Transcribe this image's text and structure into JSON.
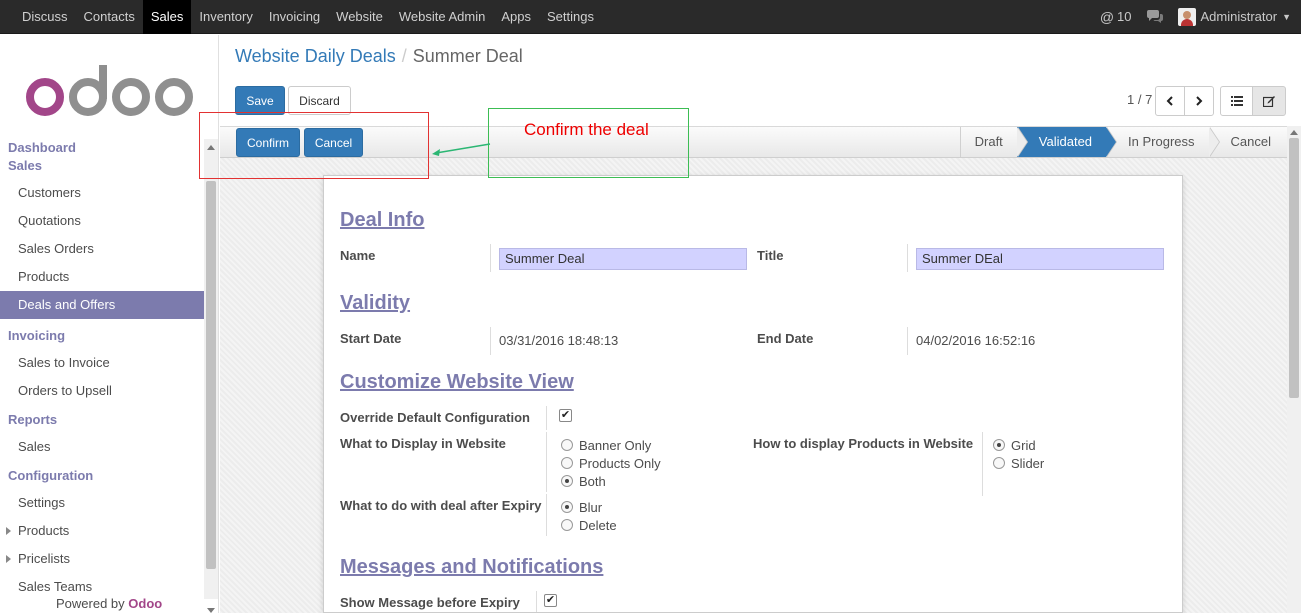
{
  "topbar": {
    "menu": [
      "Discuss",
      "Contacts",
      "Sales",
      "Inventory",
      "Invoicing",
      "Website",
      "Website Admin",
      "Apps",
      "Settings"
    ],
    "active": "Sales",
    "mentions": "10",
    "user": "Administrator"
  },
  "sidebar": {
    "logo_text": "odoo",
    "sections": [
      {
        "head": "Dashboard",
        "items": []
      },
      {
        "head": "Sales",
        "items": [
          "Customers",
          "Quotations",
          "Sales Orders",
          "Products",
          "Deals and Offers"
        ]
      },
      {
        "head": "Invoicing",
        "items": [
          "Sales to Invoice",
          "Orders to Upsell"
        ]
      },
      {
        "head": "Reports",
        "items": [
          "Sales"
        ]
      },
      {
        "head": "Configuration",
        "items": [
          "Settings",
          "Products",
          "Pricelists",
          "Sales Teams"
        ]
      }
    ],
    "active_item": "Deals and Offers",
    "powered_prefix": "Powered by",
    "powered_brand": "Odoo"
  },
  "breadcrumb": {
    "parent": "Website Daily Deals",
    "sep": "/",
    "current": "Summer Deal"
  },
  "buttons": {
    "save": "Save",
    "discard": "Discard",
    "confirm": "Confirm",
    "cancel": "Cancel"
  },
  "pager": {
    "text": "1 / 7"
  },
  "stages": {
    "items": [
      "Draft",
      "Validated",
      "In Progress",
      "Cancel"
    ],
    "active": "Validated"
  },
  "annotation": {
    "text": "Confirm the deal"
  },
  "form": {
    "deal_info": {
      "title": "Deal Info",
      "name_label": "Name",
      "name_value": "Summer Deal",
      "title_label": "Title",
      "title_value": "Summer DEal"
    },
    "validity": {
      "title": "Validity",
      "start_label": "Start Date",
      "start_value": "03/31/2016 18:48:13",
      "end_label": "End Date",
      "end_value": "04/02/2016 16:52:16"
    },
    "customize": {
      "title": "Customize Website View",
      "override_label": "Override Default Configuration",
      "override_checked": true,
      "display_label": "What to Display in Website",
      "display_options": [
        "Banner Only",
        "Products Only",
        "Both"
      ],
      "display_selected": "Both",
      "products_label": "How to display Products in Website",
      "products_options": [
        "Grid",
        "Slider"
      ],
      "products_selected": "Grid",
      "expiry_label": "What to do with deal after Expiry",
      "expiry_options": [
        "Blur",
        "Delete"
      ],
      "expiry_selected": "Blur"
    },
    "messages": {
      "title": "Messages and Notifications",
      "show_msg_label": "Show Message before Expiry",
      "show_msg_checked": true
    }
  },
  "colors": {
    "brand": "#7c7bad",
    "primary": "#337ab7",
    "topbar": "#2a2a2a",
    "input_bg": "#d2d2ff"
  }
}
